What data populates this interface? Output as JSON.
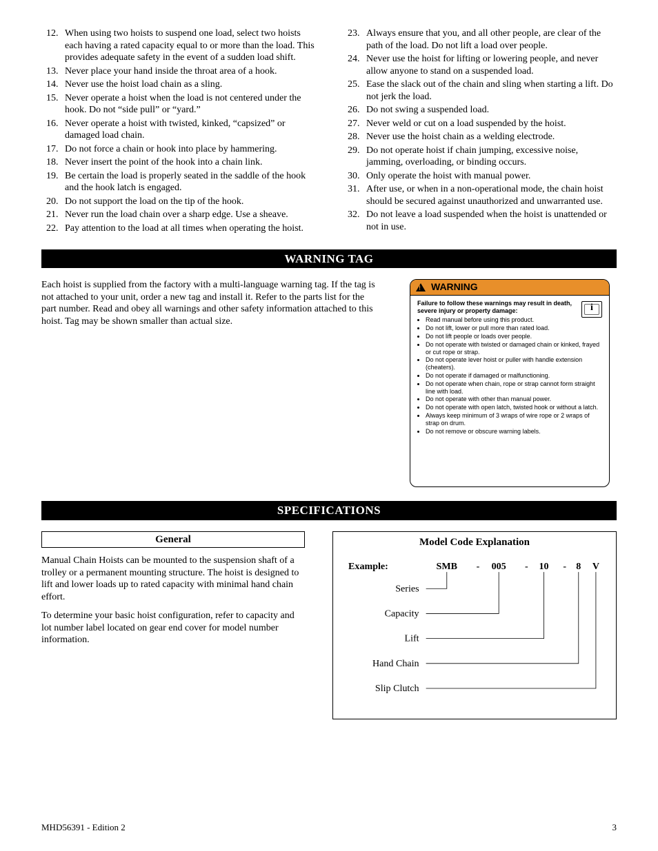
{
  "left_list": [
    "When using two hoists to suspend one load, select two hoists each having a rated capacity equal to or more than the load. This provides adequate safety in the event of a sudden load shift.",
    "Never place your hand inside the throat area of a hook.",
    "Never use the hoist load chain as a sling.",
    "Never operate a hoist when the load is not centered under the hook. Do not “side pull” or “yard.”",
    "Never operate a hoist with twisted, kinked, “capsized” or damaged load chain.",
    "Do not force a chain or hook into place by hammering.",
    "Never insert the point of the hook into a chain link.",
    "Be certain the load is properly seated in the saddle of the hook and the hook latch is engaged.",
    "Do not support the load on the tip of the hook.",
    "Never run the load chain over a sharp edge. Use a sheave.",
    "Pay attention to the load at all times when operating the hoist."
  ],
  "left_start": 12,
  "right_list": [
    "Always ensure that you, and all other people, are clear of the path of the load. Do not lift a load over people.",
    "Never use the hoist for lifting or lowering people, and never allow anyone to stand on a suspended load.",
    "Ease the slack out of the chain and sling when starting a lift. Do not jerk the load.",
    "Do not swing a suspended load.",
    "Never weld or cut on a load suspended by the hoist.",
    "Never use the hoist chain as a welding electrode.",
    "Do not operate hoist if chain jumping, excessive noise, jamming, overloading, or binding occurs.",
    "Only operate the hoist with manual power.",
    "After use, or when in a non-operational mode, the chain hoist should be secured against unauthorized and unwarranted use.",
    "Do not leave a load suspended when the hoist is unattended or not in use."
  ],
  "right_start": 23,
  "sections": {
    "warning_tag": "WARNING TAG",
    "specifications": "SPECIFICATIONS"
  },
  "warning_tag_paragraph": "Each hoist is supplied from the factory with a multi-language warning tag. If the tag is not attached to your unit, order a new tag and install it. Refer to the parts list for the part number. Read and obey all warnings and other safety information attached to this hoist. Tag may be shown smaller than actual size.",
  "warning_card": {
    "header": "WARNING",
    "intro": "Failure to follow these warnings may result in death, severe injury or property damage:",
    "bullets": [
      "Read manual before using this product.",
      "Do not lift, lower or pull more than rated load.",
      "Do not lift people or loads over people.",
      "Do not operate with twisted or damaged chain or kinked, frayed or cut rope or strap.",
      "Do not operate lever hoist or puller with handle extension (cheaters).",
      "Do not operate if damaged or malfunctioning.",
      "Do not operate when chain, rope or strap cannot form straight line with load.",
      "Do not operate with other than manual power.",
      "Do not operate with open latch, twisted hook or without a latch.",
      "Always keep minimum of 3 wraps of wire rope or 2 wraps of strap on drum.",
      "Do not remove or obscure warning labels."
    ]
  },
  "general": {
    "heading": "General",
    "p1": "Manual Chain Hoists can be mounted to the suspension shaft of a trolley or a permanent mounting structure. The hoist is designed to lift and lower loads up to rated capacity with minimal hand chain effort.",
    "p2": "To determine your basic hoist configuration, refer to capacity and lot number label located on gear end cover for model number information."
  },
  "model_code": {
    "heading": "Model Code Explanation",
    "example": "Example:",
    "segments": [
      "SMB",
      "-",
      "005",
      "-",
      "10",
      "-",
      "8",
      "V"
    ],
    "labels": [
      "Series",
      "Capacity",
      "Lift",
      "Hand Chain",
      "Slip Clutch"
    ]
  },
  "footer": {
    "doc": "MHD56391 - Edition 2",
    "page": "3"
  }
}
